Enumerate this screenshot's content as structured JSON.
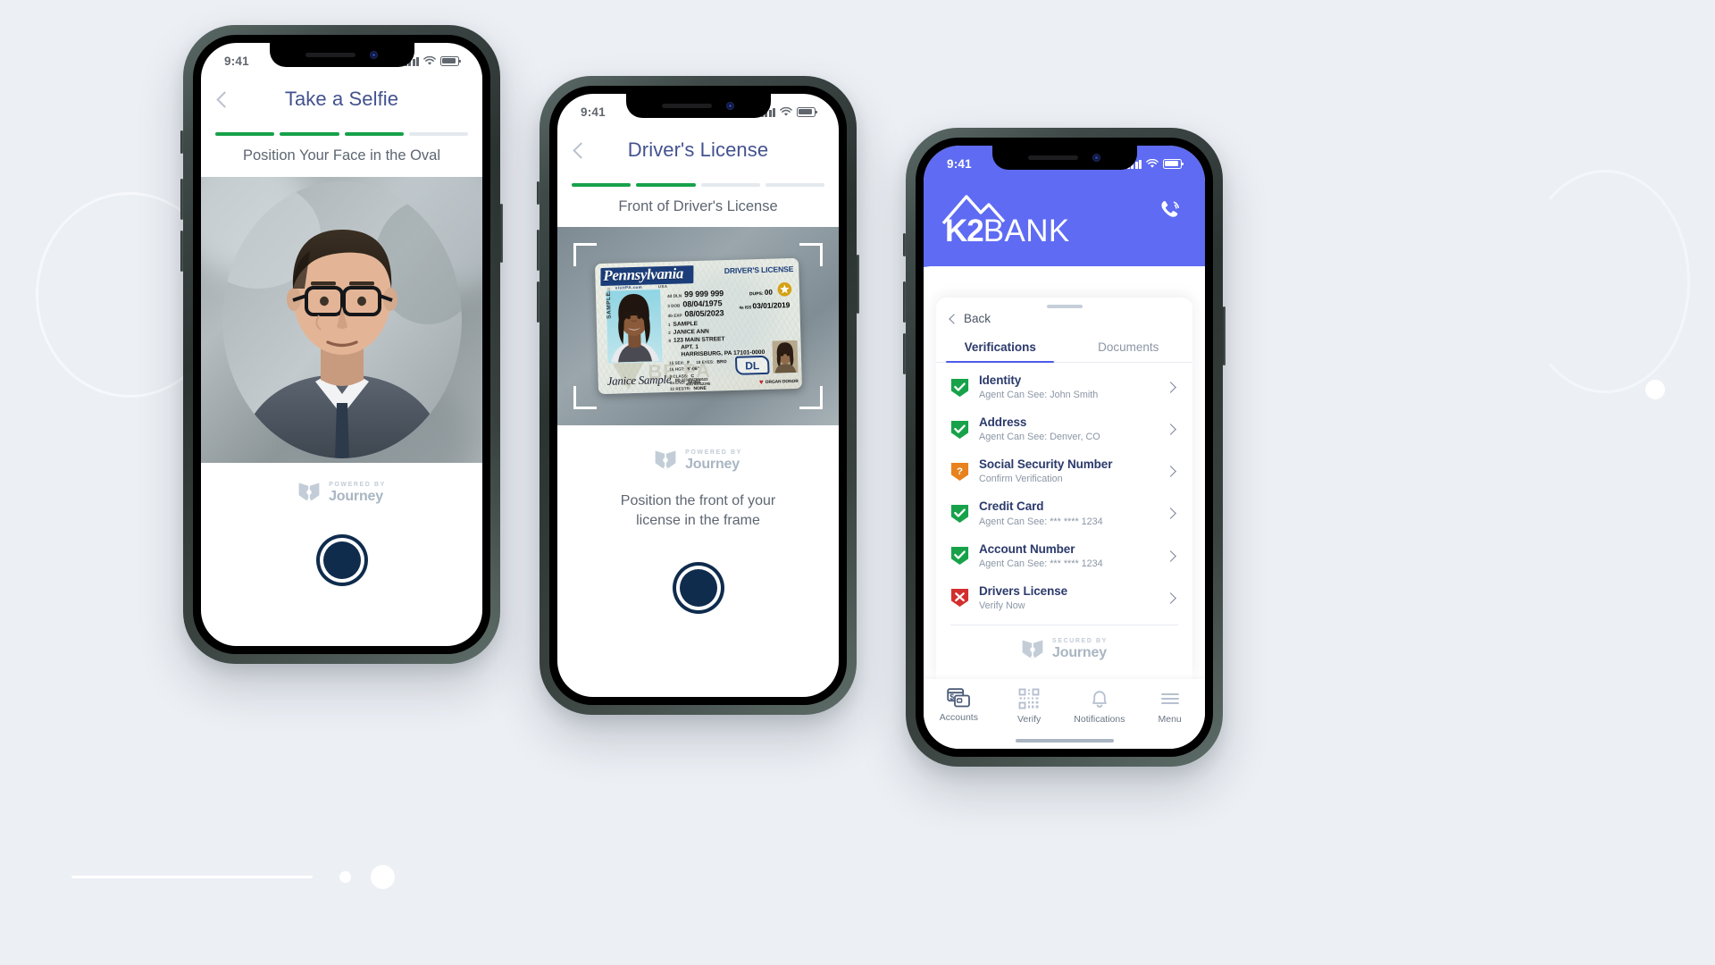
{
  "theme": {
    "brand_blue": "#5e6bf2",
    "navy": "#0f2c4d",
    "green": "#17a24a",
    "red": "#d32f2f",
    "orange": "#e8821e",
    "title_blue": "#43528f",
    "page_bg": "#eceff4"
  },
  "carousel": {
    "dots": [
      "small",
      "large"
    ]
  },
  "phone1": {
    "status": {
      "time": "9:41",
      "signal_icon": "cellular-signal-icon",
      "wifi_icon": "wifi-icon",
      "battery_icon": "battery-icon"
    },
    "nav": {
      "back_icon": "chevron-left-icon",
      "title": "Take a Selfie"
    },
    "progress": {
      "segments": [
        "on",
        "on",
        "on",
        "off"
      ]
    },
    "subtitle": "Position Your Face in the Oval",
    "camera": {
      "oval_mask_name": "face-oval-guide",
      "subject": "selfie-preview"
    },
    "footer_logo": {
      "kicker": "POWERED BY",
      "word": "Journey",
      "mark": "journey-shield-icon"
    },
    "shutter": {
      "label": "capture-button"
    }
  },
  "phone2": {
    "status": {
      "time": "9:41",
      "signal_icon": "cellular-signal-icon",
      "wifi_icon": "wifi-icon",
      "battery_icon": "battery-icon"
    },
    "nav": {
      "back_icon": "chevron-left-icon",
      "title": "Driver's License"
    },
    "progress": {
      "segments": [
        "on",
        "on",
        "off",
        "off"
      ]
    },
    "subtitle": "Front of Driver's License",
    "hint_line1": "Position the front of your",
    "hint_line2": "license in the frame",
    "footer_logo": {
      "kicker": "POWERED BY",
      "word": "Journey",
      "mark": "journey-shield-icon"
    },
    "shutter": {
      "label": "capture-button"
    },
    "license": {
      "state": "Pennsylvania",
      "state_site": "visitPA.com",
      "country": "USA",
      "doc_title": "DRIVER'S LICENSE",
      "dln_label": "4d DLN",
      "dln": "99 999 999",
      "dob_label": "3 DOB",
      "dob": "08/04/1975",
      "exp_label": "4b EXP",
      "exp": "08/05/2023",
      "dups_label": "DUPS:",
      "dups": "00",
      "iss_label": "4a ISS",
      "iss": "03/01/2019",
      "last_name_label": "1",
      "last_name": "SAMPLE",
      "first_name_label": "2",
      "first_name": "JANICE ANN",
      "addr_label": "8",
      "addr_line1": "123 MAIN STREET",
      "addr_line2": "APT. 1",
      "addr_line3": "HARRISBURG, PA 17101-0000",
      "sex_label": "15 SEX:",
      "sex": "F",
      "eyes_label": "18 EYES:",
      "eyes": "BRO",
      "hgt_label": "16 HGT:",
      "hgt": "5'-06\"",
      "class_label": "9  CLASS:",
      "class": "C",
      "end_label": "9a END:",
      "end": "NONE",
      "restr_label": "12 RESTR:",
      "restr": "NONE",
      "dd_label": "5",
      "dd_line1": "DD-1234567890123",
      "dd_line2": "456789012345",
      "signature": "Janice Sample",
      "sample_watermark": "SAMPLE",
      "card_code": "123",
      "dl_tag": "DL",
      "organ_donor": "ORGAN DONOR",
      "star_icon": "gold-star-icon"
    }
  },
  "phone3": {
    "status": {
      "time": "9:41",
      "signal_icon": "cellular-signal-icon",
      "wifi_icon": "wifi-icon",
      "battery_icon": "battery-icon"
    },
    "brand": {
      "bold": "K2",
      "light": "BANK",
      "mountain_icon": "mountain-peaks-icon"
    },
    "call_icon": "phone-ringing-icon",
    "back_label": "Back",
    "tabs": [
      {
        "label": "Verifications",
        "active": true
      },
      {
        "label": "Documents",
        "active": false
      }
    ],
    "verifications": [
      {
        "title": "Identity",
        "subtitle": "Agent Can See: John Smith",
        "status": "verified",
        "icon": "shield-check-icon"
      },
      {
        "title": "Address",
        "subtitle": "Agent Can See: Denver, CO",
        "status": "verified",
        "icon": "shield-check-icon"
      },
      {
        "title": "Social Security Number",
        "subtitle": "Confirm Verification",
        "status": "pending",
        "icon": "shield-question-icon"
      },
      {
        "title": "Credit Card",
        "subtitle": "Agent Can See: *** **** 1234",
        "status": "verified",
        "icon": "shield-check-icon"
      },
      {
        "title": "Account Number",
        "subtitle": "Agent Can See: *** **** 1234",
        "status": "verified",
        "icon": "shield-check-icon"
      },
      {
        "title": "Drivers License",
        "subtitle": "Verify Now",
        "status": "failed",
        "icon": "shield-x-icon"
      }
    ],
    "footer_logo": {
      "kicker": "SECURED BY",
      "word": "Journey",
      "mark": "journey-shield-icon"
    },
    "tabbar": [
      {
        "label": "Accounts",
        "icon": "accounts-card-icon"
      },
      {
        "label": "Verify",
        "icon": "qr-code-icon"
      },
      {
        "label": "Notifications",
        "icon": "bell-icon"
      },
      {
        "label": "Menu",
        "icon": "hamburger-menu-icon"
      }
    ]
  }
}
